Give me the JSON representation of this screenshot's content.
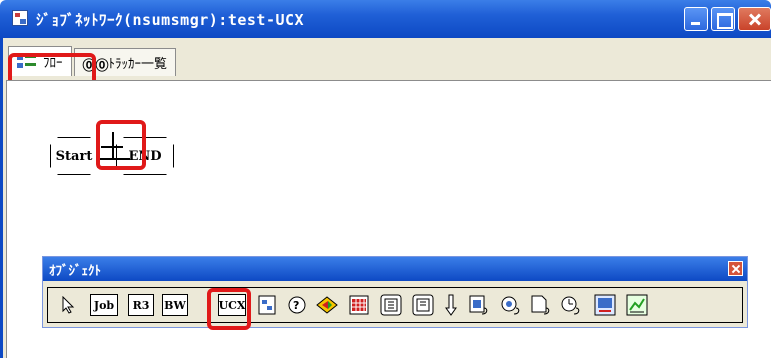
{
  "window": {
    "title": "ｼﾞｮﾌﾞﾈｯﾄﾜｰｸ(nsumsmgr):test-UCX"
  },
  "tabs": [
    {
      "label": "ﾌﾛｰ",
      "icon": "flow-icon",
      "active": true
    },
    {
      "label": "ﾄﾗｯｶｰ一覧",
      "icon": "tracker-icon",
      "active": false
    }
  ],
  "flow": {
    "start_label": "Start",
    "end_label": "END"
  },
  "palette": {
    "title": "ｵﾌﾞｼﾞｪｸﾄ",
    "tools": [
      {
        "name": "pointer-tool",
        "label": ""
      },
      {
        "name": "job-tool",
        "label": "Job"
      },
      {
        "name": "r3-tool",
        "label": "R3"
      },
      {
        "name": "bw-tool",
        "label": "BW"
      },
      {
        "name": "ucx-tool",
        "label": "UCX"
      },
      {
        "name": "jobnet-tool",
        "label": ""
      },
      {
        "name": "condition-tool",
        "label": ""
      },
      {
        "name": "branch-tool",
        "label": ""
      },
      {
        "name": "calendar-tool",
        "label": ""
      },
      {
        "name": "tool-10",
        "label": ""
      },
      {
        "name": "tool-11",
        "label": ""
      },
      {
        "name": "arrow-down-tool",
        "label": ""
      },
      {
        "name": "tool-13",
        "label": ""
      },
      {
        "name": "tool-14",
        "label": ""
      },
      {
        "name": "tool-15",
        "label": ""
      },
      {
        "name": "tool-16",
        "label": ""
      },
      {
        "name": "tool-17",
        "label": ""
      },
      {
        "name": "tool-18",
        "label": ""
      }
    ]
  },
  "colors": {
    "titlebar": "#0d49c4",
    "highlight": "#e01919",
    "frame": "#ece9d8"
  }
}
